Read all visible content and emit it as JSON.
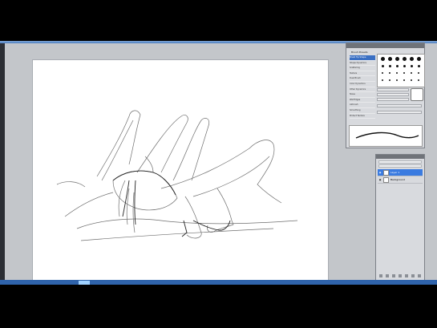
{
  "app": {
    "accent": "#3a6fc3",
    "workspace_color": "#c3c6ca"
  },
  "brush_panel": {
    "tab_label": "Brush Presets",
    "items": [
      {
        "label": "Brush Tip Shape",
        "selected": true
      },
      {
        "label": "Shape Dynamics",
        "selected": false
      },
      {
        "label": "Scattering",
        "selected": false
      },
      {
        "label": "Texture",
        "selected": false
      },
      {
        "label": "Dual Brush",
        "selected": false
      },
      {
        "label": "Color Dynamics",
        "selected": false
      },
      {
        "label": "Other Dynamics",
        "selected": false
      },
      {
        "label": "Noise",
        "selected": false
      },
      {
        "label": "Wet Edges",
        "selected": false
      },
      {
        "label": "Airbrush",
        "selected": false
      },
      {
        "label": "Smoothing",
        "selected": false
      },
      {
        "label": "Protect Texture",
        "selected": false
      }
    ]
  },
  "layers_panel": {
    "layers": [
      {
        "name": "Layer 1",
        "selected": true,
        "visible": true
      },
      {
        "name": "Background",
        "selected": false,
        "visible": true
      }
    ]
  }
}
